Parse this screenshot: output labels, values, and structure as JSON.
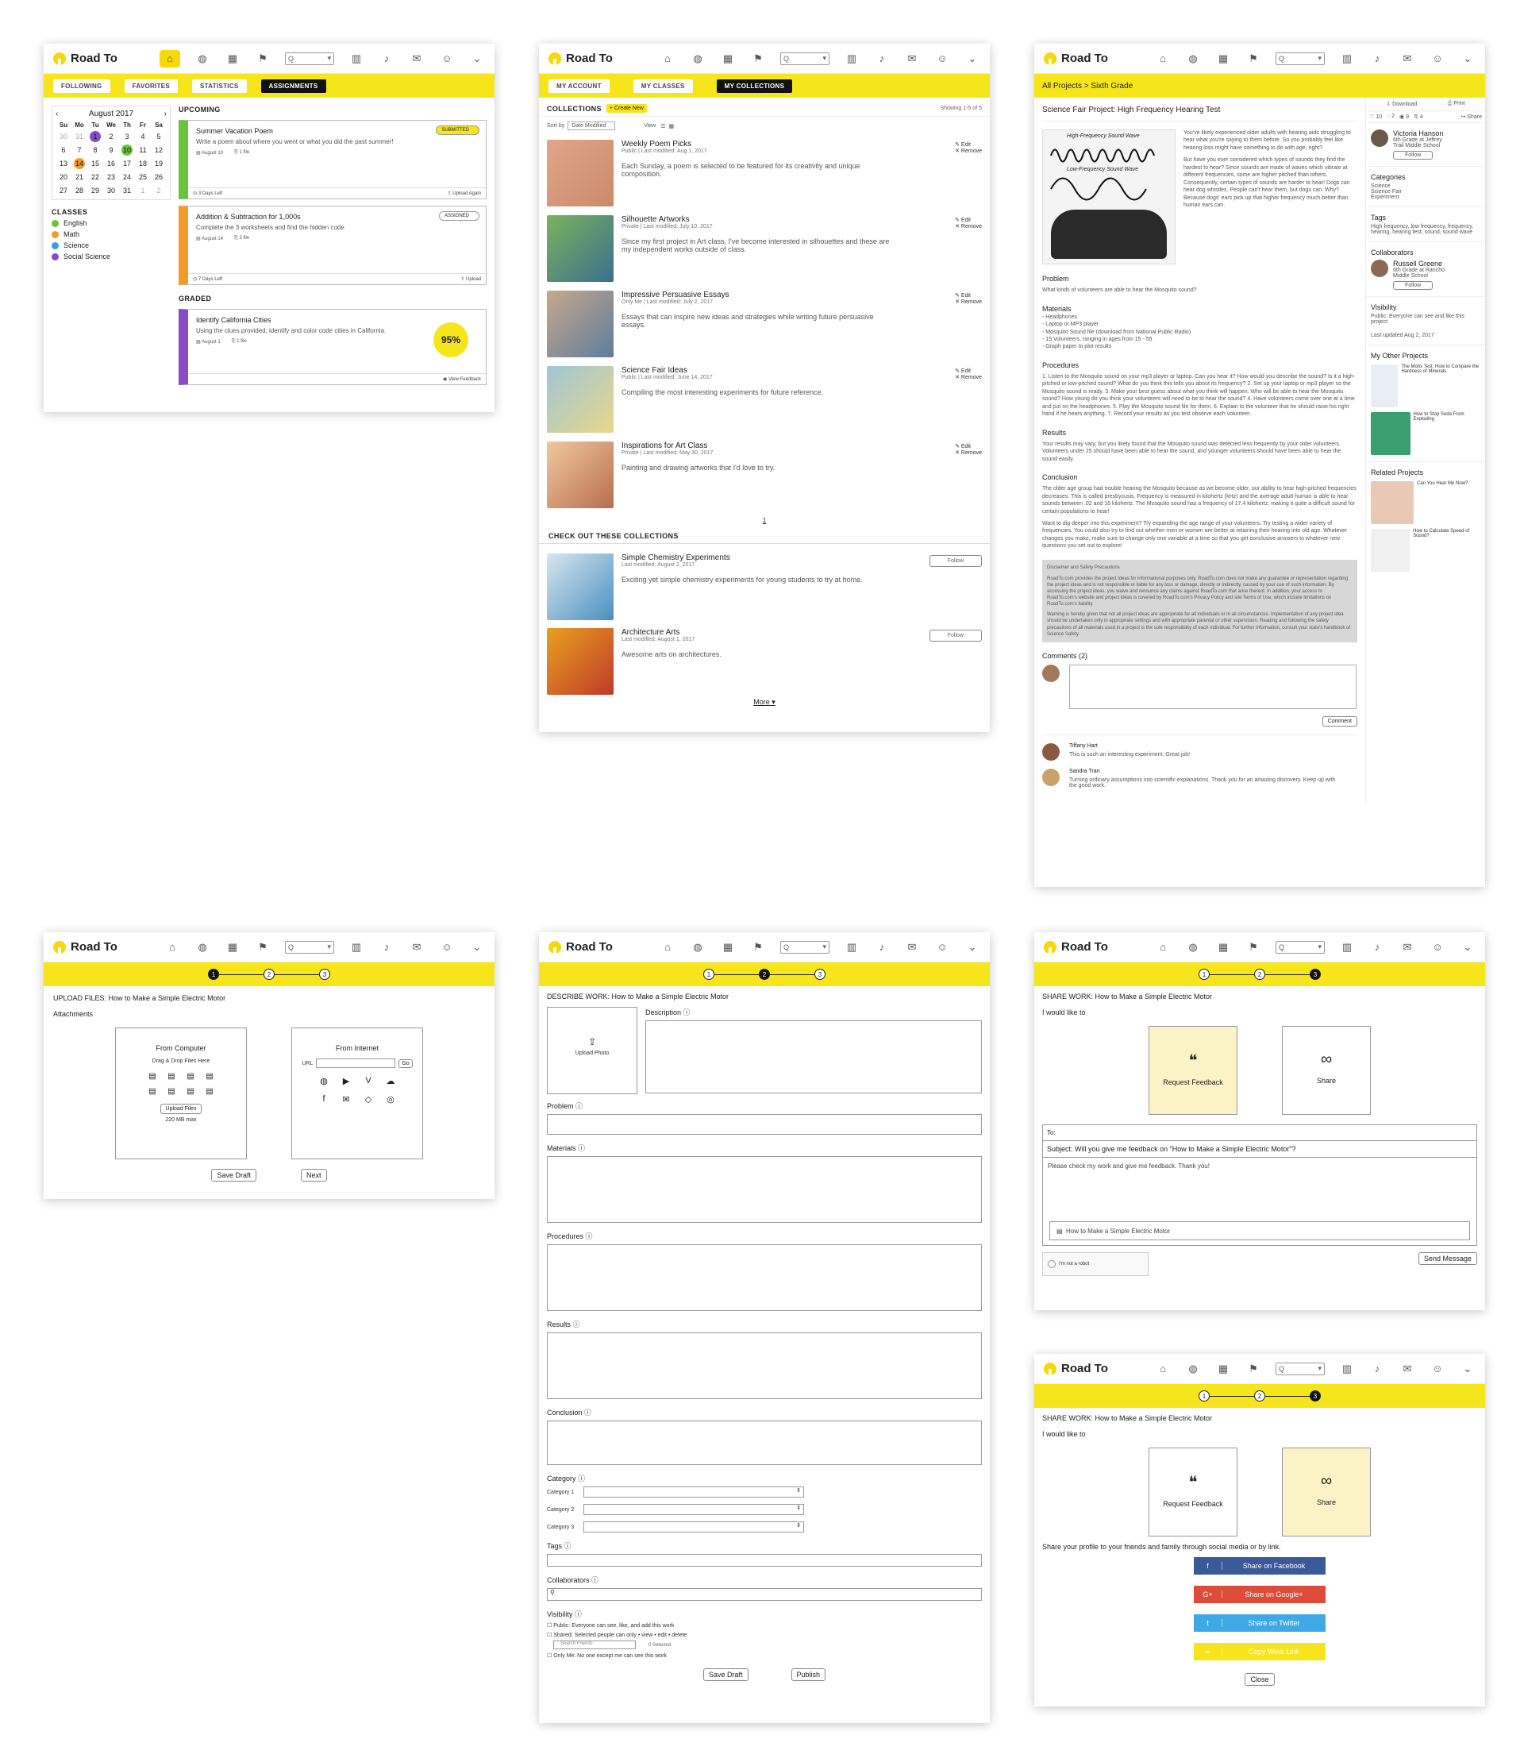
{
  "app": {
    "name": "Road To",
    "search_placeholder": "Q"
  },
  "p1": {
    "tabs": [
      "FOLLOWING",
      "FAVORITES",
      "STATISTICS",
      "ASSIGNMENTS"
    ],
    "calendar": {
      "month": "August 2017",
      "days": [
        "Su",
        "Mo",
        "Tu",
        "We",
        "Th",
        "Fr",
        "Sa"
      ],
      "rows": [
        [
          "30",
          "31",
          "1",
          "2",
          "3",
          "4",
          "5"
        ],
        [
          "6",
          "7",
          "8",
          "9",
          "10",
          "11",
          "12"
        ],
        [
          "13",
          "14",
          "15",
          "16",
          "17",
          "18",
          "19"
        ],
        [
          "20",
          "21",
          "22",
          "23",
          "24",
          "25",
          "26"
        ],
        [
          "27",
          "28",
          "29",
          "30",
          "31",
          "1",
          "2"
        ]
      ]
    },
    "classes_title": "CLASSES",
    "classes": [
      {
        "name": "English",
        "color": "#6ac23d"
      },
      {
        "name": "Math",
        "color": "#f39a28"
      },
      {
        "name": "Science",
        "color": "#3a9be0"
      },
      {
        "name": "Social Science",
        "color": "#8a4bc8"
      }
    ],
    "upcoming_title": "UPCOMING",
    "graded_title": "GRADED",
    "cards": [
      {
        "title": "Summer Vacation Poem",
        "desc": "Write a poem about where you went or what you did the past summer!",
        "date": "August 10",
        "files": "1 file",
        "left": "3 Days Left",
        "action": "Upload Again",
        "status": "SUBMITTED",
        "color": "#6ac23d"
      },
      {
        "title": "Addition & Subtraction for 1,000s",
        "desc": "Complete the 3 worksheets and find the hidden code",
        "date": "August 14",
        "files": "3 file",
        "left": "7 Days Left",
        "action": "Upload",
        "status": "ASSIGNED",
        "color": "#f39a28"
      },
      {
        "title": "Identify California Cities",
        "desc": "Using the clues provided, identify and color code cities in California.",
        "date": "August 1",
        "files": "1 file",
        "grade": "95%",
        "action": "View Feedback",
        "color": "#8a4bc8"
      }
    ]
  },
  "p2": {
    "tabs": [
      "MY ACCOUNT",
      "MY CLASSES",
      "MY COLLECTIONS"
    ],
    "title": "COLLECTIONS",
    "create": "+ Create New",
    "showing": "Showing 1-5 of 5",
    "sort_label": "Sort by",
    "sort_value": "Date Modified",
    "view_label": "View",
    "edit": "Edit",
    "remove": "Remove",
    "items": [
      {
        "title": "Weekly Poem Picks",
        "meta": "Public  |  Last modified: Aug 1, 2017",
        "desc": "Each Sunday, a poem is selected to be featured for its creativity and unique composition."
      },
      {
        "title": "Silhouette Artworks",
        "meta": "Private  |  Last modified: July 10, 2017",
        "desc": "Since my first project in Art class, I've become interested in silhouettes and these are my independent works outside of class."
      },
      {
        "title": "Impressive Persuasive Essays",
        "meta": "Only Me  |  Last modified: July 2, 2017",
        "desc": "Essays that can inspire new ideas and strategies while writing future persuasive essays."
      },
      {
        "title": "Science Fair Ideas",
        "meta": "Public  |  Last modified: June 14, 2017",
        "desc": "Compiling the most interesting experiments for future reference."
      },
      {
        "title": "Inspirations for Art Class",
        "meta": "Private  |  Last modified: May 30, 2017",
        "desc": "Painting and drawing artworks that I'd love to try."
      }
    ],
    "page": "1",
    "checkout": "CHECK OUT THESE COLLECTIONS",
    "suggested": [
      {
        "title": "Simple Chemistry Experiments",
        "meta": "Last modified: August 2, 2017",
        "desc": "Exciting yet simple chemistry experiments for young students to try at home."
      },
      {
        "title": "Architecture Arts",
        "meta": "Last modified: August 1, 2017",
        "desc": "Awesome arts on architectures."
      }
    ],
    "follow": "Follow",
    "more": "More"
  },
  "p3": {
    "crumb": "All Projects > Sixth Grade",
    "title": "Science Fair Project: High Frequency Hearing Test",
    "download": "Download",
    "print": "Print",
    "share": "Share",
    "stats": {
      "likes": "10",
      "comments": "2",
      "views": "9",
      "saves": "4"
    },
    "img_top": "High-Frequency Sound Wave",
    "img_bot": "Low-Frequency Sound Wave",
    "intro": "You've likely experienced older adults with hearing aids struggling to hear what you're saying to them before. So you probably feel like hearing loss might have something to do with age, right?",
    "intro2": "But have you ever considered which types of sounds they find the hardest to hear? Since sounds are made of waves which vibrate at different frequencies, some are higher pitched than others. Consequently, certain types of sounds are harder to hear! Dogs can hear dog whistles. People can't hear them, but dogs can. Why? Because dogs' ears pick up that higher frequency much better than human ears can.",
    "problem_h": "Problem",
    "problem": "What kinds of volunteers are able to hear the Mosquito sound?",
    "materials_h": "Materials",
    "materials": [
      "- Headphones",
      "- Laptop or MP3 player",
      "- Mosquito Sound file (download from National Public Radio)",
      "- 15 Volunteers, ranging in ages from 15 - 55",
      "- Graph paper to plot results"
    ],
    "procedures_h": "Procedures",
    "procedures": "1. Listen to the Mosquito sound on your mp3 player or laptop. Can you hear it? How would you describe the sound? Is it a high-pitched or low-pitched sound? What do you think this tells you about its frequency? 2. Set up your laptop or mp3 player so the Mosquito sound is ready. 3. Make your best guess about what you think will happen. Who will be able to hear the Mosquito sound? How young do you think your volunteers will need to be to hear the sound? 4. Have volunteers come over one at a time and put on the headphones. 5. Play the Mosquito sound file for them. 6. Explain to the volunteer that he should raise his right hand if he hears anything. 7. Record your results as you test observe each volunteer.",
    "results_h": "Results",
    "results": "Your results may vary, but you likely found that the Mosquito sound was detected less frequently by your older volunteers. Volunteers under 25 should have been able to hear the sound, and younger volunteers should have been able to hear the sound easily.",
    "conclusion_h": "Conclusion",
    "conclusion": "The older age group had trouble hearing the Mosquito because as we become older, our ability to hear high-pitched frequencies decreases. This is called presbycusis. Frequency is measured in kilohertz (kHz) and the average adult human is able to hear sounds between .02 and 16 kilohertz. The Mosquito sound has a frequency of 17.4 kilohertz, making it quite a difficult sound for certain populations to hear!",
    "conclusion2": "Want to dig deeper into this experiment? Try expanding the age range of your volunteers. Try testing a wider variety of frequencies. You could also try to find out whether men or women are better at retaining their hearing into old age. Whatever changes you make, make sure to change only one variable at a time so that you get conclusive answers to whatever new questions you set out to explore!",
    "disclaimer_h": "Disclaimer and Safety Precautions",
    "disclaimer": "RoadTo.com provides the project ideas for informational purposes only. RoadTo.com does not make any guarantee or representation regarding the project ideas and is not responsible or liable for any loss or damage, directly or indirectly, caused by your use of such information. By accessing the project ideas, you waive and renounce any claims against RoadTo.com that arise thereof. In addition, your access to RoadTo.com's website and project ideas is covered by RoadTo.com's Privacy Policy and site Terms of Use, which include limitations on RoadTo.com's liability.",
    "disclaimer2": "Warning is hereby given that not all project ideas are appropriate for all individuals or in all circumstances. Implementation of any project idea should be undertaken only in appropriate settings and with appropriate parental or other supervision. Reading and following the safety precautions of all materials used in a project is the sole responsibility of each individual. For further information, consult your state's handbook of Science Safety.",
    "comments_h": "Comments (2)",
    "comment_btn": "Comment",
    "comments": [
      {
        "name": "Tiffany Hart",
        "text": "This is such an interesting experiment. Great job!"
      },
      {
        "name": "Sandra Tran",
        "text": "Turning ordinary assumptions into scientific explanations. Thank you for an amazing discovery. Keep up with the good work."
      }
    ],
    "author": {
      "name": "Victoria Hanson",
      "sub": "6th Grade at Jeffrey Trail Middle School",
      "follow": "Follow"
    },
    "categories_h": "Categories",
    "categories": "Science\nScience Fair\nExperiment",
    "tags_h": "Tags",
    "tags": "High frequency, low frequency, frequency, hearing, hearing test, sound, sound wave",
    "collab_h": "Collaborators",
    "collab": {
      "name": "Russell Greene",
      "sub": "6th Grade at Rancho Middle School",
      "follow": "Follow"
    },
    "visibility_h": "Visibility",
    "visibility": "Public: Everyone can see and like this project",
    "updated": "Last updated Aug 2, 2017",
    "other_h": "My Other Projects",
    "other": [
      "The Mohs Test: How to Compare the Hardness of Minerals",
      "How to Stop Soda From Exploding"
    ],
    "related_h": "Related Projects",
    "related": [
      "Can You Hear Me Now?",
      "How to Calculate Speed of Sound?"
    ]
  },
  "p4": {
    "steps": [
      "1",
      "2",
      "3"
    ],
    "title": "UPLOAD FILES: How to Make a Simple Electric Motor",
    "attachments": "Attachments",
    "computer": "From Computer",
    "drag": "Drag & Drop Files Here",
    "upload": "Upload Files",
    "max": "220 MB max",
    "internet": "From Internet",
    "url": "URL",
    "go": "Go",
    "save": "Save Draft",
    "next": "Next"
  },
  "p5": {
    "title": "DESCRIBE WORK: How to Make a Simple Electric Motor",
    "upload_photo": "Upload Photo",
    "description": "Description",
    "problem": "Problem",
    "materials": "Materials",
    "procedures": "Procedures",
    "results": "Results",
    "conclusion": "Conclusion",
    "category": "Category",
    "cat1": "Category 1",
    "cat2": "Category 2",
    "cat3": "Category 3",
    "tags": "Tags",
    "collaborators": "Collaborators",
    "visibility": "Visibility",
    "vis_public": "Public: Everyone can see, like, and add this work",
    "vis_shared": "Shared: Selected people can only  • view  • edit  • delete",
    "search_friends": "Search Friends",
    "selected": "0 Selected",
    "vis_only": "Only Me: No one except me can see this work",
    "save": "Save Draft",
    "publish": "Publish"
  },
  "p6": {
    "title": "SHARE WORK: How to Make a Simple Electric Motor",
    "like": "I would like to",
    "feedback": "Request Feedback",
    "share": "Share",
    "to": "To:",
    "subject": "Subject: Will you give me feedback on \"How to Make a Simple Electric Motor\"?",
    "body": "Please check my work and give me feedback. Thank you!",
    "attach": "How to Make a Simple Electric Motor",
    "captcha": "I'm not a robot",
    "send": "Send Message"
  },
  "p7": {
    "title": "SHARE WORK: How to Make a Simple Electric Motor",
    "like": "I would like to",
    "feedback": "Request Feedback",
    "share": "Share",
    "share_text": "Share your profile to your friends and family through social media or by link.",
    "buttons": [
      {
        "label": "Share on Facebook",
        "icon": "f",
        "color": "#3b5998"
      },
      {
        "label": "Share on Google+",
        "icon": "G+",
        "color": "#dd4b39"
      },
      {
        "label": "Share on Twitter",
        "icon": "t",
        "color": "#3fa9e8"
      },
      {
        "label": "Copy Work Link",
        "icon": "∞",
        "color": "#f6e51a"
      }
    ],
    "close": "Close"
  }
}
